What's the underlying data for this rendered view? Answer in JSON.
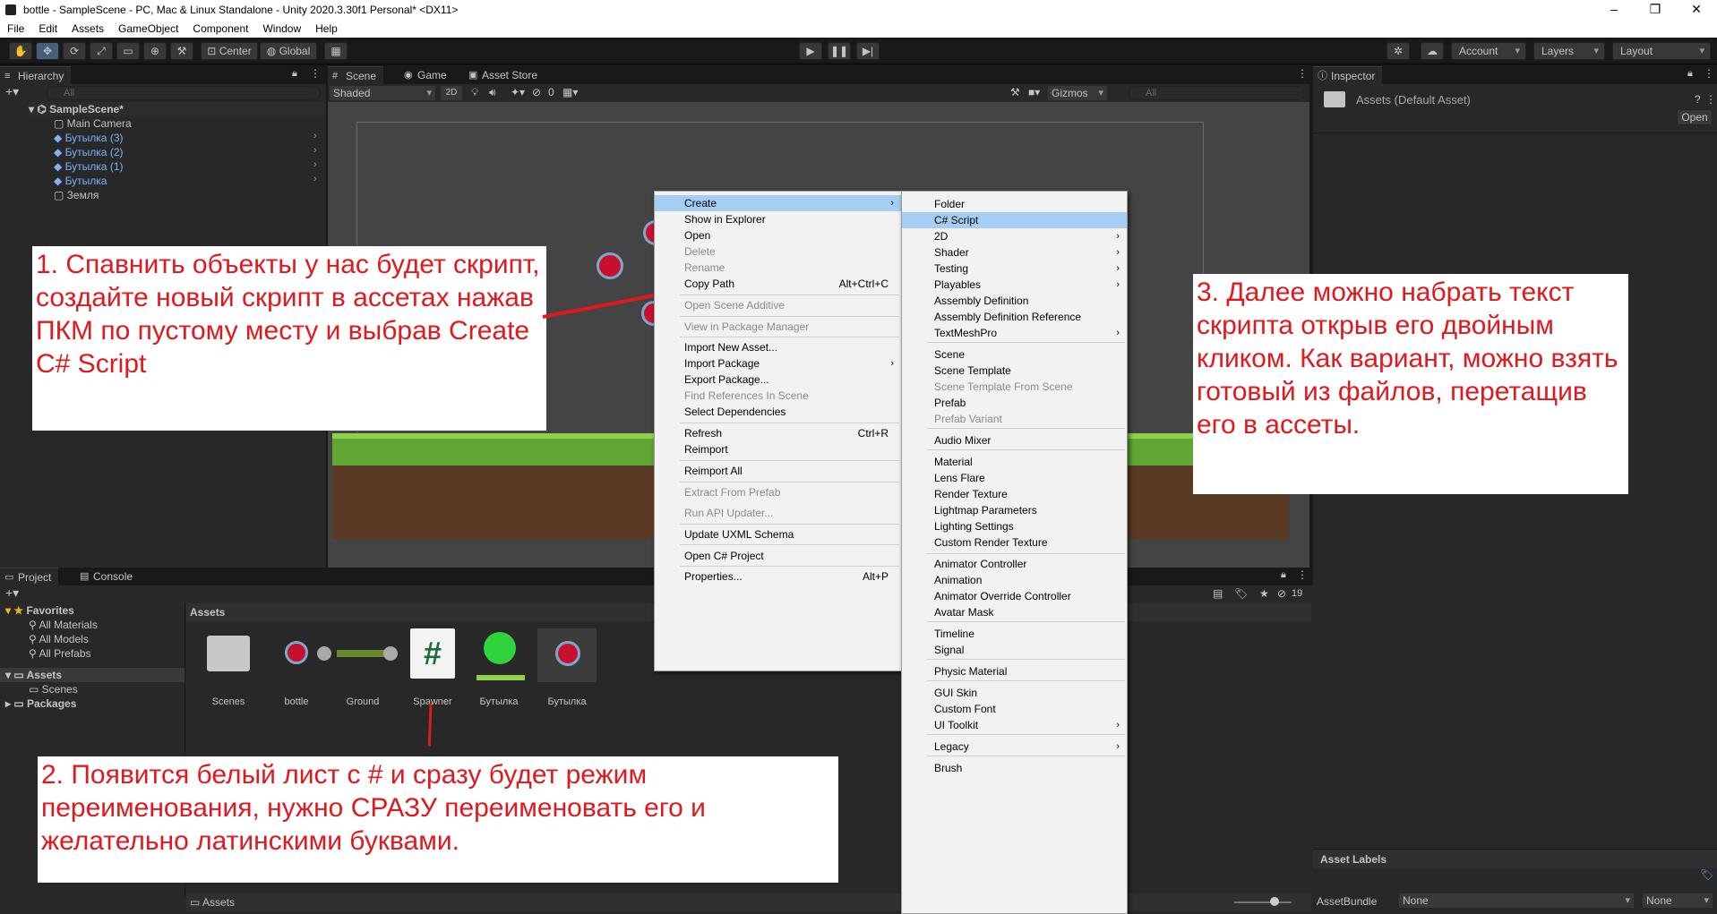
{
  "window": {
    "title": "bottle - SampleScene - PC, Mac & Linux Standalone - Unity 2020.3.30f1 Personal* <DX11>",
    "min": "–",
    "max": "❐",
    "close": "✕"
  },
  "menu": [
    "File",
    "Edit",
    "Assets",
    "GameObject",
    "Component",
    "Window",
    "Help"
  ],
  "toolbar": {
    "center": "Center",
    "global": "Global",
    "account": "Account",
    "layers": "Layers",
    "layout": "Layout"
  },
  "hierarchy": {
    "tab": "Hierarchy",
    "search_placeholder": "All",
    "scene": "SampleScene*",
    "items": [
      "Main Camera",
      "Бутылка (3)",
      "Бутылка (2)",
      "Бутылка (1)",
      "Бутылка",
      "Земля"
    ]
  },
  "scene": {
    "tabs": [
      "Scene",
      "Game",
      "Asset Store"
    ],
    "shading": "Shaded",
    "mode2d": "2D",
    "layers_count": "0",
    "gizmos": "Gizmos",
    "search_placeholder": "All"
  },
  "inspector": {
    "tab": "Inspector",
    "asset": "Assets (Default Asset)",
    "open": "Open",
    "asset_labels": "Asset Labels",
    "asset_bundle": "AssetBundle",
    "bundle_value": "None",
    "variant_value": "None"
  },
  "project": {
    "tabs": [
      "Project",
      "Console"
    ],
    "favorites": "Favorites",
    "fav_items": [
      "All Materials",
      "All Models",
      "All Prefabs"
    ],
    "assets": "Assets",
    "assets_children": [
      "Scenes"
    ],
    "packages": "Packages",
    "breadcrumb": "Assets",
    "footer": "Assets",
    "hidden_count": "19",
    "assets_grid": [
      {
        "label": "Scenes"
      },
      {
        "label": "bottle"
      },
      {
        "label": "Ground"
      },
      {
        "label": "Spawner"
      },
      {
        "label": "Бутылка"
      },
      {
        "label": "Бутылка"
      }
    ]
  },
  "context_menu": {
    "items": [
      {
        "label": "Create",
        "shortcut": "",
        "arrow": "›",
        "state": "hl"
      },
      {
        "label": "Show in Explorer",
        "shortcut": "",
        "arrow": "",
        "state": ""
      },
      {
        "label": "Open",
        "shortcut": "",
        "arrow": "",
        "state": ""
      },
      {
        "label": "Delete",
        "shortcut": "",
        "arrow": "",
        "state": "dis"
      },
      {
        "label": "Rename",
        "shortcut": "",
        "arrow": "",
        "state": "dis"
      },
      {
        "label": "Copy Path",
        "shortcut": "Alt+Ctrl+C",
        "arrow": "",
        "state": ""
      },
      {
        "label": "Open Scene Additive",
        "shortcut": "",
        "arrow": "",
        "state": "dis"
      },
      {
        "label": "View in Package Manager",
        "shortcut": "",
        "arrow": "",
        "state": "dis"
      },
      {
        "label": "Import New Asset...",
        "shortcut": "",
        "arrow": "",
        "state": ""
      },
      {
        "label": "Import Package",
        "shortcut": "",
        "arrow": "›",
        "state": ""
      },
      {
        "label": "Export Package...",
        "shortcut": "",
        "arrow": "",
        "state": ""
      },
      {
        "label": "Find References In Scene",
        "shortcut": "",
        "arrow": "",
        "state": "dis"
      },
      {
        "label": "Select Dependencies",
        "shortcut": "",
        "arrow": "",
        "state": ""
      },
      {
        "label": "Refresh",
        "shortcut": "Ctrl+R",
        "arrow": "",
        "state": ""
      },
      {
        "label": "Reimport",
        "shortcut": "",
        "arrow": "",
        "state": ""
      },
      {
        "label": "Reimport All",
        "shortcut": "",
        "arrow": "",
        "state": ""
      },
      {
        "label": "Extract From Prefab",
        "shortcut": "",
        "arrow": "",
        "state": "dis"
      },
      {
        "label": "Run API Updater...",
        "shortcut": "",
        "arrow": "",
        "state": "dis"
      },
      {
        "label": "Update UXML Schema",
        "shortcut": "",
        "arrow": "",
        "state": ""
      },
      {
        "label": "Open C# Project",
        "shortcut": "",
        "arrow": "",
        "state": ""
      },
      {
        "label": "Properties...",
        "shortcut": "Alt+P",
        "arrow": "",
        "state": ""
      }
    ]
  },
  "create_menu": {
    "items": [
      {
        "label": "Folder",
        "arrow": "",
        "state": ""
      },
      {
        "label": "C# Script",
        "arrow": "",
        "state": "hl"
      },
      {
        "label": "2D",
        "arrow": "›",
        "state": ""
      },
      {
        "label": "Shader",
        "arrow": "›",
        "state": ""
      },
      {
        "label": "Testing",
        "arrow": "›",
        "state": ""
      },
      {
        "label": "Playables",
        "arrow": "›",
        "state": ""
      },
      {
        "label": "Assembly Definition",
        "arrow": "",
        "state": ""
      },
      {
        "label": "Assembly Definition Reference",
        "arrow": "",
        "state": ""
      },
      {
        "label": "TextMeshPro",
        "arrow": "›",
        "state": ""
      },
      {
        "label": "Scene",
        "arrow": "",
        "state": ""
      },
      {
        "label": "Scene Template",
        "arrow": "",
        "state": ""
      },
      {
        "label": "Scene Template From Scene",
        "arrow": "",
        "state": "dis"
      },
      {
        "label": "Prefab",
        "arrow": "",
        "state": ""
      },
      {
        "label": "Prefab Variant",
        "arrow": "",
        "state": "dis"
      },
      {
        "label": "Audio Mixer",
        "arrow": "",
        "state": ""
      },
      {
        "label": "Material",
        "arrow": "",
        "state": ""
      },
      {
        "label": "Lens Flare",
        "arrow": "",
        "state": ""
      },
      {
        "label": "Render Texture",
        "arrow": "",
        "state": ""
      },
      {
        "label": "Lightmap Parameters",
        "arrow": "",
        "state": ""
      },
      {
        "label": "Lighting Settings",
        "arrow": "",
        "state": ""
      },
      {
        "label": "Custom Render Texture",
        "arrow": "",
        "state": ""
      },
      {
        "label": "Animator Controller",
        "arrow": "",
        "state": ""
      },
      {
        "label": "Animation",
        "arrow": "",
        "state": ""
      },
      {
        "label": "Animator Override Controller",
        "arrow": "",
        "state": ""
      },
      {
        "label": "Avatar Mask",
        "arrow": "",
        "state": ""
      },
      {
        "label": "Timeline",
        "arrow": "",
        "state": ""
      },
      {
        "label": "Signal",
        "arrow": "",
        "state": ""
      },
      {
        "label": "Physic Material",
        "arrow": "",
        "state": ""
      },
      {
        "label": "GUI Skin",
        "arrow": "",
        "state": ""
      },
      {
        "label": "Custom Font",
        "arrow": "",
        "state": ""
      },
      {
        "label": "UI Toolkit",
        "arrow": "›",
        "state": ""
      },
      {
        "label": "Legacy",
        "arrow": "›",
        "state": ""
      },
      {
        "label": "Brush",
        "arrow": "",
        "state": ""
      }
    ]
  },
  "notes": {
    "n1": "1. Спавнить объекты у нас будет скрипт, создайте новый скрипт в ассетах нажав ПКМ по пустому месту и выбрав Create C# Script",
    "n2": "2. Появится белый лист с # и сразу будет режим переименования, нужно СРАЗУ переименовать его и желательно латинскими буквами.",
    "n3": "3. Далее можно набрать текст скрипта открыв его двойным кликом. Как вариант, можно взять готовый из файлов, перетащив его в ассеты."
  },
  "colors": {
    "accent": "#46607c",
    "annotation": "#e0191e",
    "highlight": "#a6cdf3",
    "prefab": "#7ab4f5"
  }
}
